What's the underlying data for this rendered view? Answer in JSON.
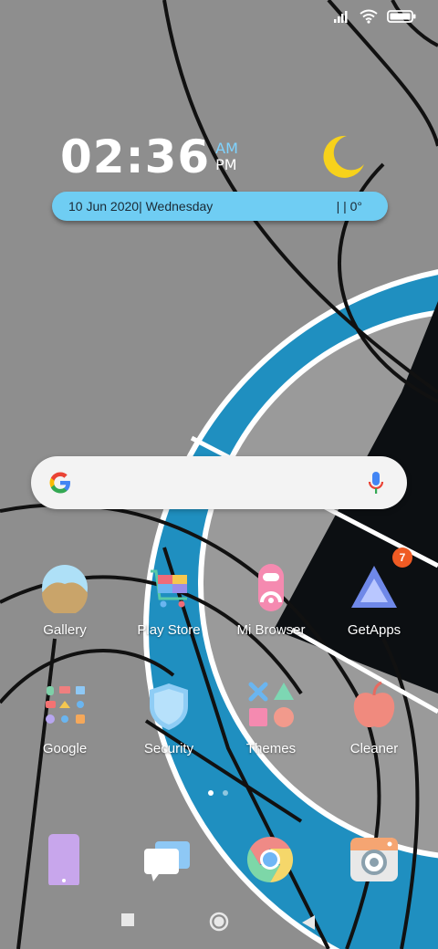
{
  "status_bar": {
    "signal_icon": "signal-icon",
    "wifi_icon": "wifi-icon",
    "battery_icon": "battery-icon"
  },
  "clock": {
    "time": "02:36",
    "am": "AM",
    "pm": "PM"
  },
  "weather": {
    "icon": "moon-icon",
    "date": "10 Jun 2020| Wednesday",
    "temp": "|  | 0°"
  },
  "search": {
    "logo": "google-logo-icon",
    "mic": "mic-icon"
  },
  "apps": [
    {
      "label": "Gallery",
      "icon": "gallery-icon"
    },
    {
      "label": "Play Store",
      "icon": "play-store-icon"
    },
    {
      "label": "Mi Browser",
      "icon": "mi-browser-icon"
    },
    {
      "label": "GetApps",
      "icon": "getapps-icon",
      "badge": "7"
    },
    {
      "label": "Google",
      "icon": "google-folder-icon"
    },
    {
      "label": "Security",
      "icon": "security-icon"
    },
    {
      "label": "Themes",
      "icon": "themes-icon"
    },
    {
      "label": "Cleaner",
      "icon": "cleaner-icon"
    }
  ],
  "page_indicator": {
    "pages": 2,
    "active": 1
  },
  "dock": [
    {
      "icon": "phone-icon"
    },
    {
      "icon": "messages-icon"
    },
    {
      "icon": "chrome-icon"
    },
    {
      "icon": "camera-icon"
    }
  ],
  "nav_bar": {
    "recents": "recents-icon",
    "home": "home-icon",
    "back": "back-icon"
  },
  "colors": {
    "accent": "#6fcdf3",
    "badge": "#ef5b24",
    "wallpaper_blue": "#1f8fc0"
  }
}
